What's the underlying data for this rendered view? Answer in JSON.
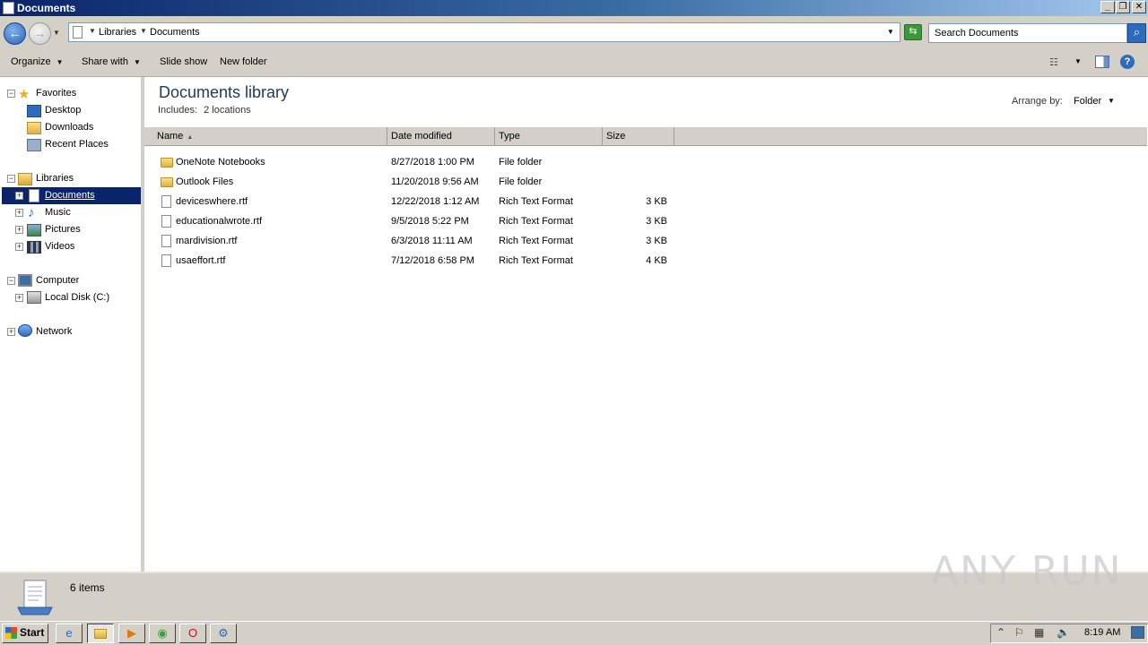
{
  "window": {
    "title": "Documents"
  },
  "address": {
    "crumbs": [
      "Libraries",
      "Documents"
    ],
    "search_placeholder": "Search Documents"
  },
  "toolbar": {
    "organize": "Organize",
    "share_with": "Share with",
    "slide_show": "Slide show",
    "new_folder": "New folder"
  },
  "nav": {
    "favorites": "Favorites",
    "desktop": "Desktop",
    "downloads": "Downloads",
    "recent_places": "Recent Places",
    "libraries": "Libraries",
    "documents": "Documents",
    "music": "Music",
    "pictures": "Pictures",
    "videos": "Videos",
    "computer": "Computer",
    "local_disk": "Local Disk (C:)",
    "network": "Network"
  },
  "library": {
    "title": "Documents library",
    "includes_label": "Includes:",
    "includes_link": "2 locations",
    "arrange_label": "Arrange by:",
    "arrange_value": "Folder"
  },
  "columns": {
    "name": "Name",
    "date": "Date modified",
    "type": "Type",
    "size": "Size"
  },
  "files": [
    {
      "name": "OneNote Notebooks",
      "date": "8/27/2018 1:00 PM",
      "type": "File folder",
      "size": "",
      "kind": "folder"
    },
    {
      "name": "Outlook Files",
      "date": "11/20/2018 9:56 AM",
      "type": "File folder",
      "size": "",
      "kind": "folder"
    },
    {
      "name": "deviceswhere.rtf",
      "date": "12/22/2018 1:12 AM",
      "type": "Rich Text Format",
      "size": "3 KB",
      "kind": "file"
    },
    {
      "name": "educationalwrote.rtf",
      "date": "9/5/2018 5:22 PM",
      "type": "Rich Text Format",
      "size": "3 KB",
      "kind": "file"
    },
    {
      "name": "mardivision.rtf",
      "date": "6/3/2018 11:11 AM",
      "type": "Rich Text Format",
      "size": "3 KB",
      "kind": "file"
    },
    {
      "name": "usaeffort.rtf",
      "date": "7/12/2018 6:58 PM",
      "type": "Rich Text Format",
      "size": "4 KB",
      "kind": "file"
    }
  ],
  "status": {
    "count": "6 items"
  },
  "watermark": "ANY RUN",
  "taskbar": {
    "start": "Start",
    "clock": "8:19 AM"
  }
}
